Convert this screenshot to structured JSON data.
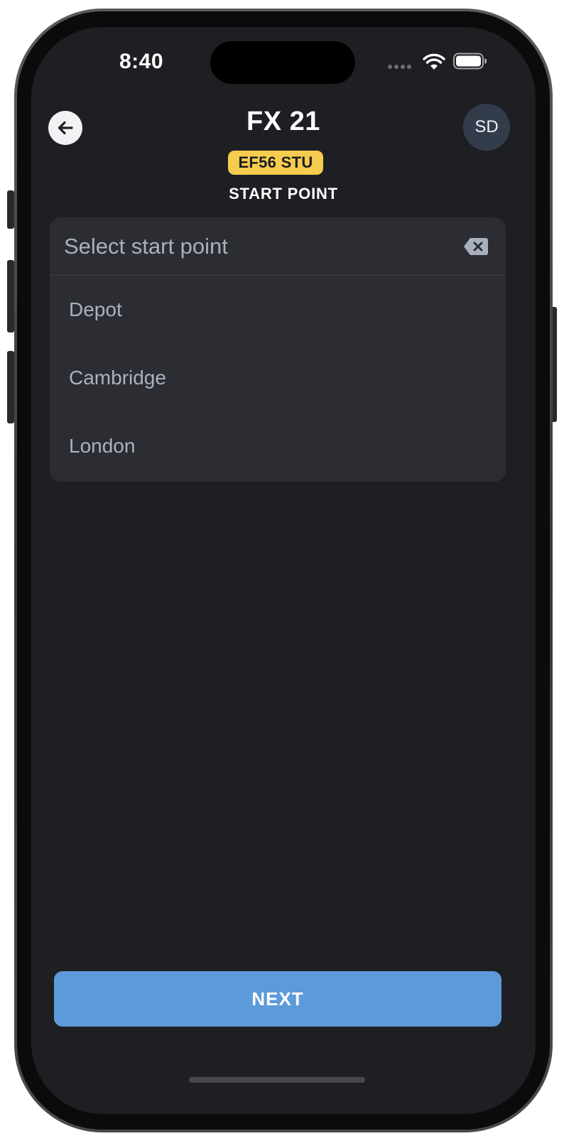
{
  "status_bar": {
    "time": "8:40",
    "icons": [
      "signal-dots-icon",
      "wifi-icon",
      "battery-icon"
    ]
  },
  "header": {
    "back_icon": "arrow-left-icon",
    "title": "FX 21",
    "plate": "EF56 STU",
    "step": "START POINT",
    "avatar_initials": "SD"
  },
  "start_point": {
    "placeholder": "Select start point",
    "clear_icon": "backspace-icon",
    "options": [
      {
        "label": "Depot"
      },
      {
        "label": "Cambridge"
      },
      {
        "label": "London"
      }
    ]
  },
  "footer": {
    "next_label": "NEXT"
  },
  "colors": {
    "background": "#1e1f23",
    "panel": "#2b2d32",
    "badge": "#f5cc4e",
    "primary_button": "#5d9ad9",
    "avatar": "#323c4b"
  }
}
